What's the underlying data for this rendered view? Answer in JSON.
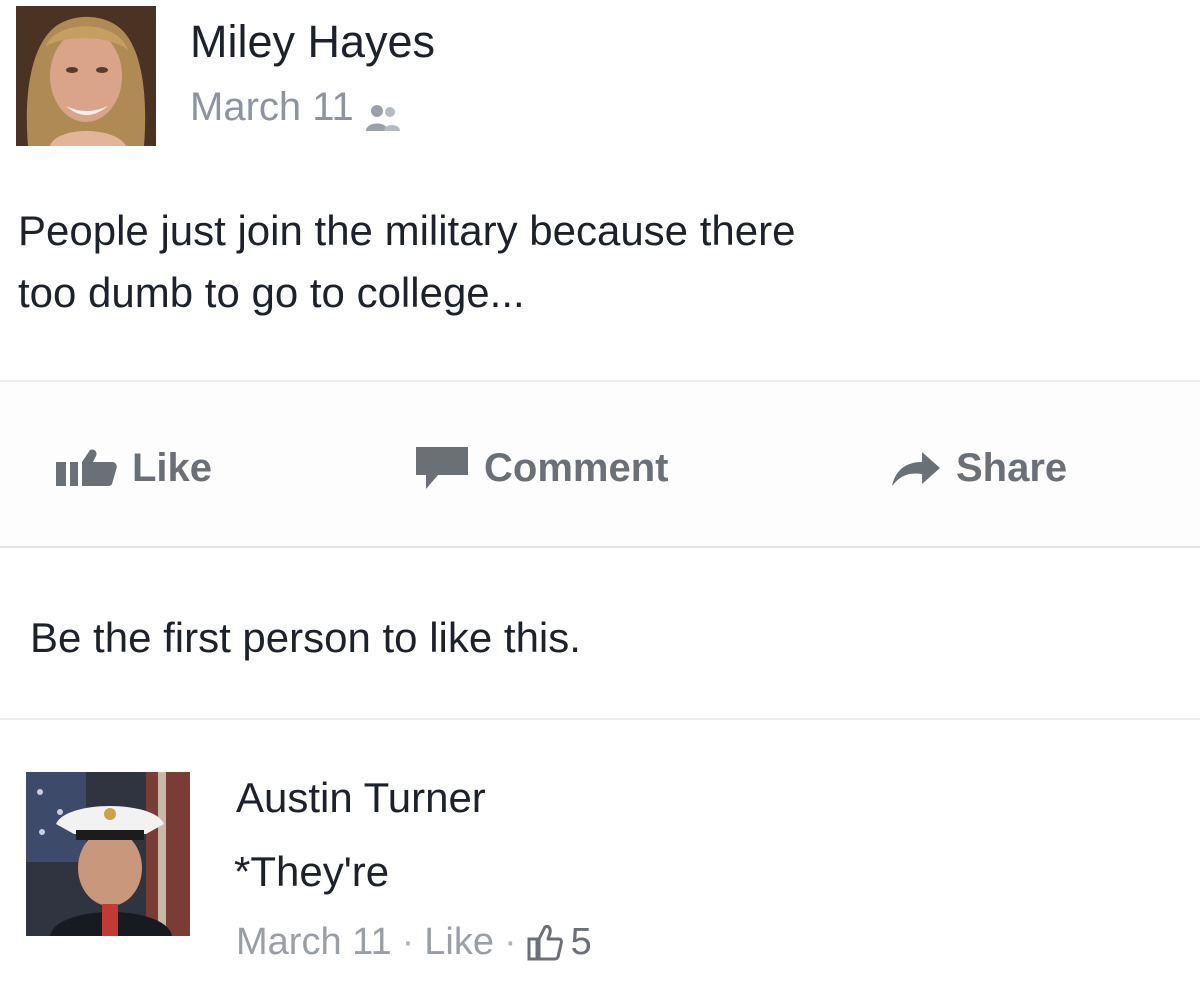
{
  "post": {
    "author": "Miley Hayes",
    "date": "March 11",
    "audience_icon": "friends-icon",
    "text_line1": "People just join the military because there",
    "text_line2": "too dumb to go to college..."
  },
  "actions": {
    "like_label": "Like",
    "comment_label": "Comment",
    "share_label": "Share"
  },
  "likes_summary": "Be the first person to like this.",
  "comment": {
    "author": "Austin Turner",
    "text": "*They're",
    "date": "March 11",
    "separator": "·",
    "like_label": "Like",
    "like_count": "5"
  },
  "colors": {
    "text": "#1d2129",
    "meta_gray": "#8d949e",
    "action_gray": "#6b6f76"
  }
}
